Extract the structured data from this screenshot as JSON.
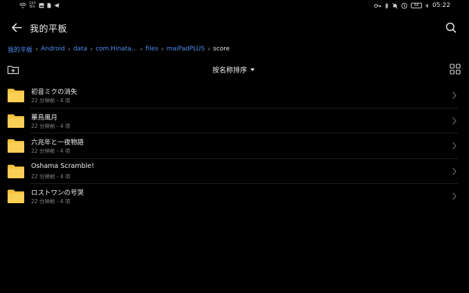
{
  "status_bar": {
    "rate_value": "193",
    "rate_unit": "B/s",
    "battery": "64",
    "time": "05:22"
  },
  "header": {
    "title": "我的平板"
  },
  "breadcrumb": [
    "我的平板",
    "Android",
    "data",
    "com.Hinata...",
    "files",
    "maiPadPLUS",
    "score"
  ],
  "toolbar": {
    "sort_label": "按名称排序"
  },
  "files": [
    {
      "name": "初音ミクの消失",
      "meta": "22 分钟前 - 4 项"
    },
    {
      "name": "華鳥風月",
      "meta": "22 分钟前 - 4 项"
    },
    {
      "name": "六兆年と一夜物語",
      "meta": "22 分钟前 - 4 项"
    },
    {
      "name": "Oshama Scramble!",
      "meta": "22 分钟前 - 4 项"
    },
    {
      "name": "ロストワンの号哭",
      "meta": "22 分钟前 - 4 项"
    }
  ],
  "colors": {
    "accent": "#4f8ff0",
    "folder": "#f6c342",
    "background": "#000000"
  },
  "icons": {
    "back": "arrow-left-icon",
    "search": "search-icon",
    "new_folder": "new-folder-icon",
    "grid": "grid-view-icon",
    "folder": "folder-icon",
    "chevron": "chevron-right-icon"
  }
}
